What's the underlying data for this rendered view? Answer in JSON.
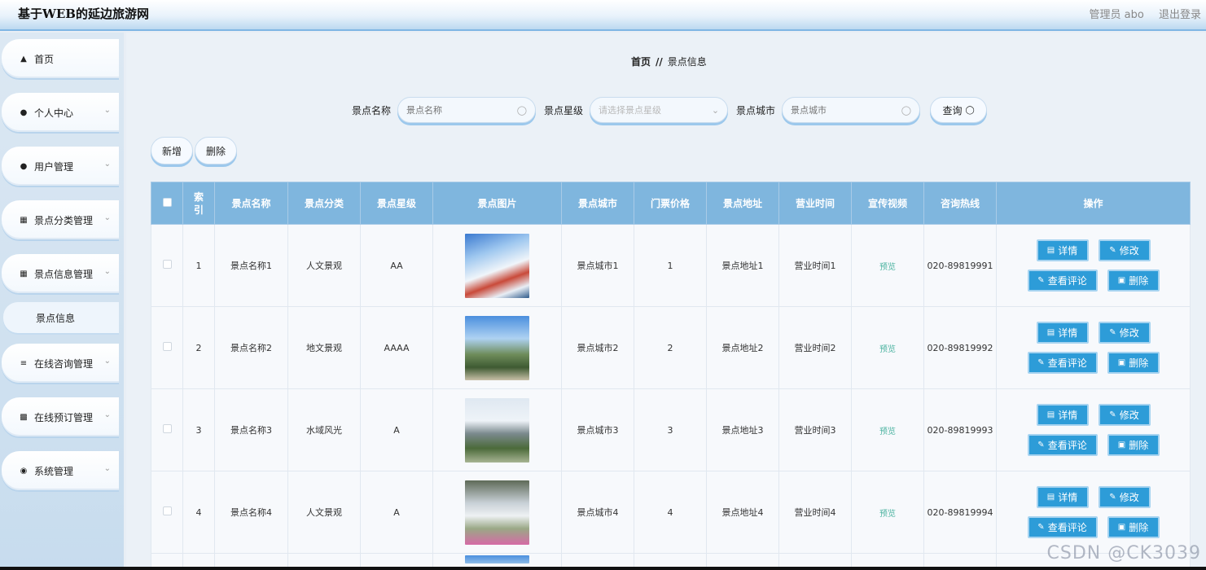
{
  "header": {
    "title": "基于WEB的延边旅游网",
    "user_label": "管理员 abo",
    "logout_label": "退出登录"
  },
  "sidebar": {
    "items": [
      {
        "label": "首页",
        "icon": "home-icon"
      },
      {
        "label": "个人中心",
        "icon": "user-icon"
      },
      {
        "label": "用户管理",
        "icon": "user-icon"
      },
      {
        "label": "景点分类管理",
        "icon": "grid-icon"
      },
      {
        "label": "景点信息管理",
        "icon": "grid-icon"
      },
      {
        "label": "在线咨询管理",
        "icon": "sliders-icon"
      },
      {
        "label": "在线预订管理",
        "icon": "chat-icon"
      },
      {
        "label": "系统管理",
        "icon": "pin-icon"
      }
    ],
    "sub_item": "景点信息"
  },
  "breadcrumb": {
    "home": "首页",
    "sep": "//",
    "current": "景点信息"
  },
  "search": {
    "name_label": "景点名称",
    "name_placeholder": "景点名称",
    "star_label": "景点星级",
    "star_placeholder": "请选择景点星级",
    "city_label": "景点城市",
    "city_placeholder": "景点城市",
    "query_label": "查询"
  },
  "actions": {
    "add": "新增",
    "delete": "删除"
  },
  "table": {
    "columns": [
      "索引",
      "景点名称",
      "景点分类",
      "景点星级",
      "景点图片",
      "景点城市",
      "门票价格",
      "景点地址",
      "营业时间",
      "宣传视频",
      "咨询热线",
      "操作"
    ],
    "preview_label": "预览",
    "op_labels": {
      "detail": "详情",
      "edit": "修改",
      "comments": "查看评论",
      "delete": "删除"
    },
    "rows": [
      {
        "index": "1",
        "name": "景点名称1",
        "category": "人文景观",
        "star": "AA",
        "city": "景点城市1",
        "price": "1",
        "address": "景点地址1",
        "hours": "营业时间1",
        "phone": "020-89819991"
      },
      {
        "index": "2",
        "name": "景点名称2",
        "category": "地文景观",
        "star": "AAAA",
        "city": "景点城市2",
        "price": "2",
        "address": "景点地址2",
        "hours": "营业时间2",
        "phone": "020-89819992"
      },
      {
        "index": "3",
        "name": "景点名称3",
        "category": "水域风光",
        "star": "A",
        "city": "景点城市3",
        "price": "3",
        "address": "景点地址3",
        "hours": "营业时间3",
        "phone": "020-89819993"
      },
      {
        "index": "4",
        "name": "景点名称4",
        "category": "人文景观",
        "star": "A",
        "city": "景点城市4",
        "price": "4",
        "address": "景点地址4",
        "hours": "营业时间4",
        "phone": "020-89819994"
      }
    ]
  },
  "watermark": "CSDN @CK3039",
  "colors": {
    "accent": "#2d9cd8",
    "table_header": "#7fb6de",
    "preview": "#4bb3a0"
  }
}
